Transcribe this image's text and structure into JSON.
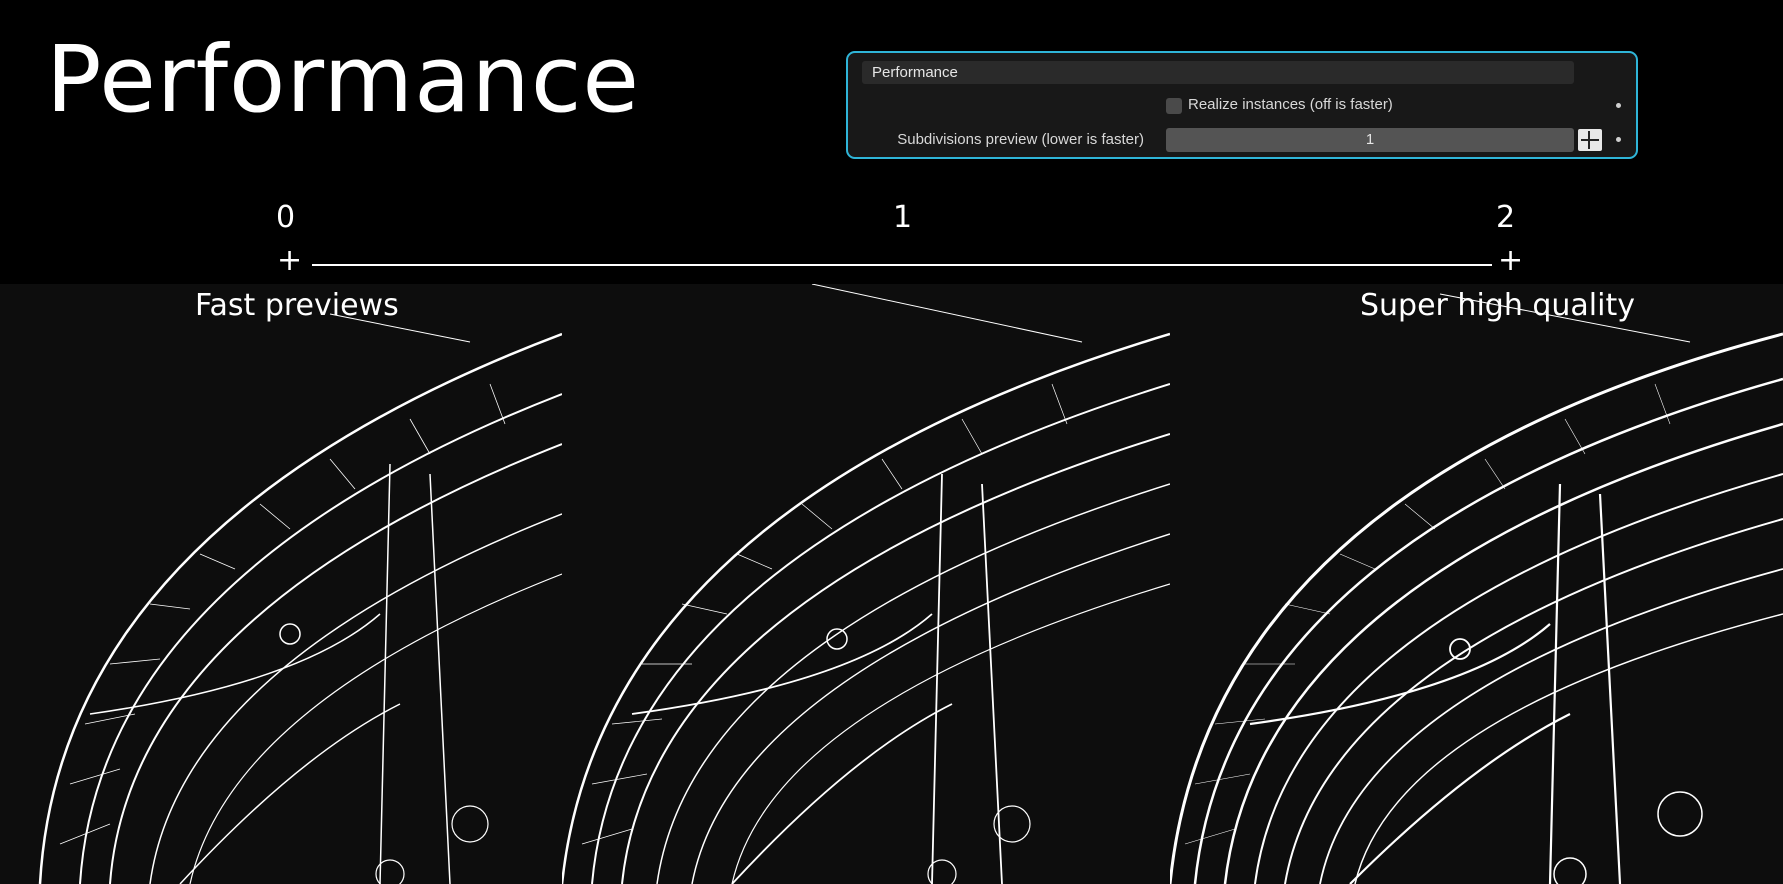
{
  "title": "Performance",
  "panel": {
    "header": "Performance",
    "realize_label": "Realize instances (off is faster)",
    "realize_checked": false,
    "subdiv_label": "Subdivisions preview (lower is faster)",
    "subdiv_value": "1"
  },
  "scale": {
    "ticks": [
      "0",
      "1",
      "2"
    ],
    "left_caption": "Fast previews",
    "right_caption": "Super high quality"
  },
  "colors": {
    "panel_border": "#2fb5d8",
    "background": "#000000",
    "viewport": "#0d0d0d",
    "wire": "#ffffff"
  }
}
